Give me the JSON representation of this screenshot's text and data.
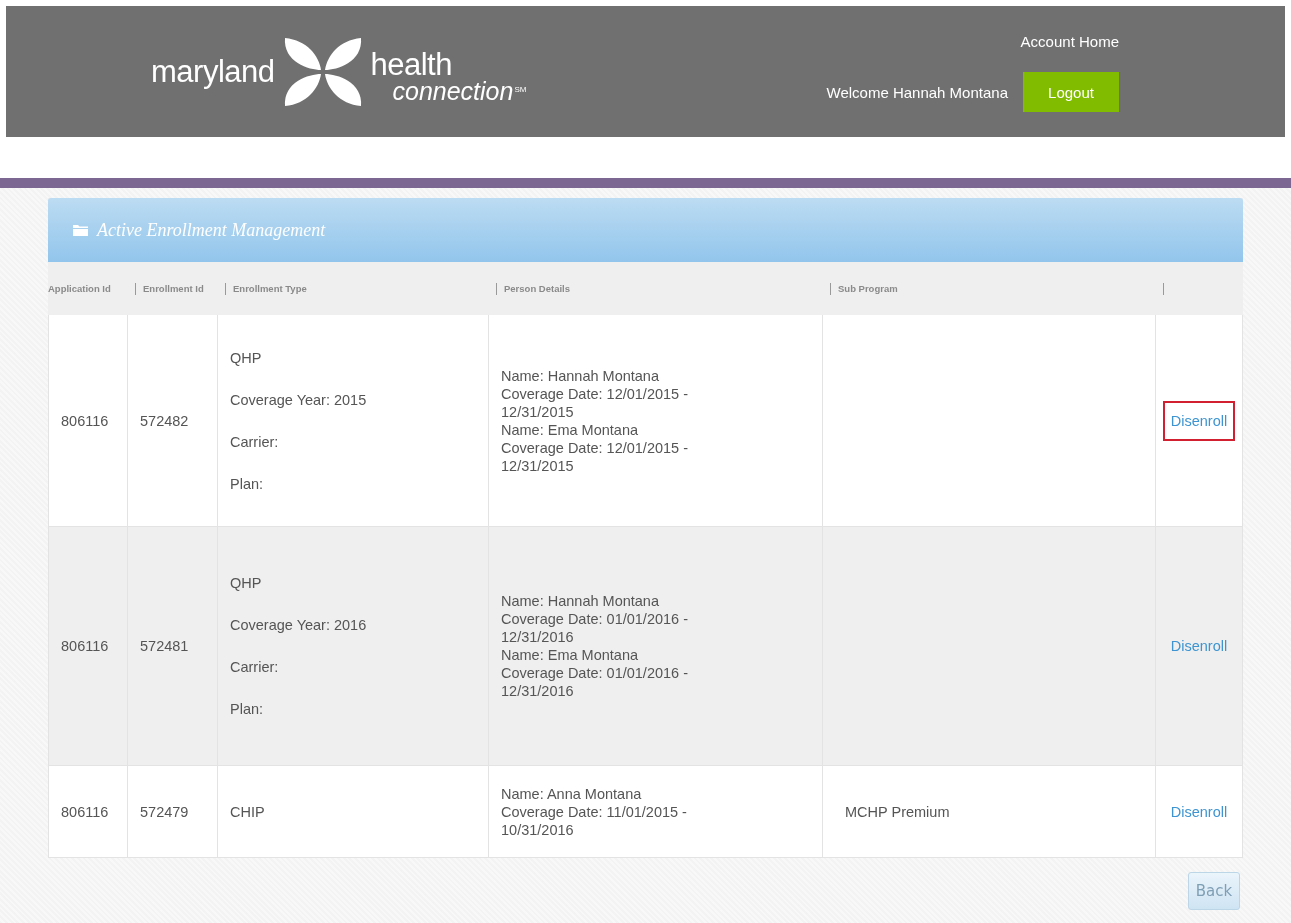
{
  "header": {
    "logo": {
      "word_1": "maryland",
      "word_2": "health",
      "word_3": "connection",
      "mark": "SM"
    },
    "account_link": "Account Home",
    "welcome": "Welcome Hannah Montana",
    "logout_button": "Logout"
  },
  "panel": {
    "title": "Active Enrollment Management",
    "columns": [
      "Application Id",
      "Enrollment Id",
      "Enrollment Type",
      "Person Details",
      "Sub Program",
      ""
    ],
    "rows": [
      {
        "selected": false,
        "application_id": "806116",
        "enrollment_id": "572482",
        "enrollment_type": [
          "QHP",
          "Coverage Year: 2015",
          "Carrier:",
          "Plan:"
        ],
        "person_details": [
          "Name: Hannah  Montana",
          "Coverage Date: 12/01/2015 -",
          "12/31/2015",
          "Name: Ema  Montana",
          "Coverage Date: 12/01/2015 -",
          "12/31/2015"
        ],
        "action": {
          "label": "Disenroll",
          "highlighted": true
        }
      },
      {
        "selected": true,
        "application_id": "806116",
        "enrollment_id": "572481",
        "enrollment_type": [
          "QHP",
          "Coverage Year: 2016",
          "Carrier:",
          "Plan:"
        ],
        "person_details": [
          "Name: Hannah  Montana",
          "Coverage Date: 01/01/2016 -",
          "12/31/2016",
          "Name: Ema  Montana",
          "Coverage Date: 01/01/2016 -",
          "12/31/2016"
        ],
        "action": {
          "label": "Disenroll",
          "highlighted": false
        }
      },
      {
        "selected": false,
        "application_id": "806116",
        "enrollment_id": "572479",
        "enrollment_type": [
          "CHIP"
        ],
        "person_details": [
          "Name: Anna  Montana",
          "Coverage Date: 11/01/2015 -",
          "10/31/2016"
        ],
        "sub_program": "MCHP Premium",
        "action": {
          "label": "Disenroll",
          "highlighted": false
        }
      }
    ]
  },
  "back_button": "Back"
}
